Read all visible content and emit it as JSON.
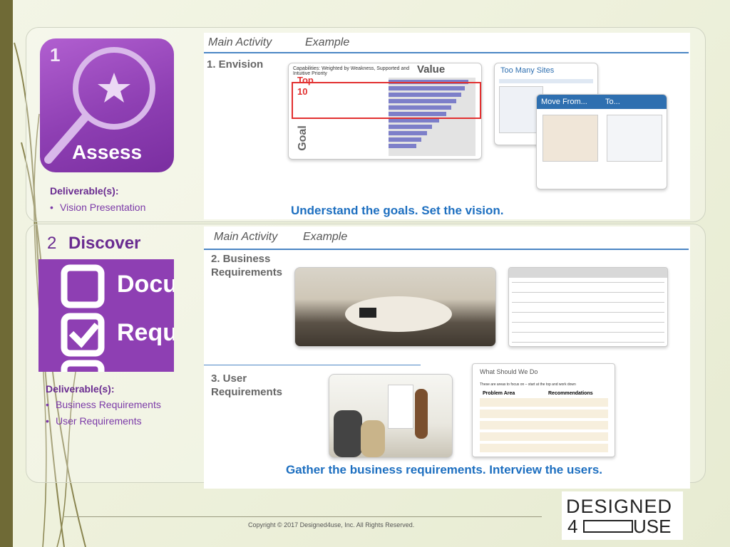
{
  "section1": {
    "badge_number": "1",
    "badge_label": "Assess",
    "deliverables_heading": "Deliverable(s):",
    "deliverables": [
      "Vision Presentation"
    ],
    "col_main": "Main Activity",
    "col_example": "Example",
    "step": "1. Envision",
    "chart_title": "Value",
    "chart_top_label": "Top",
    "chart_top_num": "10",
    "chart_axis_label": "Goal",
    "chart_subtitle": "Capabilities: Weighted by Weakness, Supported and Intuitive Priority",
    "slide1_title": "Too Many Sites",
    "slide2_title": "Move From...",
    "slide2_to": "To...",
    "tagline": "Understand the goals.  Set the vision."
  },
  "section2": {
    "number": "2",
    "title": "Discover",
    "badge_text_1": "Docu",
    "badge_text_2": "Requ",
    "deliverables_heading": "Deliverable(s):",
    "deliverables": [
      "Business Requirements",
      "User Requirements"
    ],
    "col_main": "Main Activity",
    "col_example": "Example",
    "step2_line1": "2. Business",
    "step2_line2": "Requirements",
    "step3_line1": "3. User",
    "step3_line2": "Requirements",
    "doc_title": "What Should We Do",
    "doc_intro": "These are areas to focus on – start at the top and work down",
    "doc_col1": "Problem Area",
    "doc_col2": "Recommendations",
    "tagline": "Gather the business requirements.  Interview the users."
  },
  "footer": {
    "copyright": "Copyright © 2017 Designed4use, Inc. All Rights Reserved.",
    "logo_top": "DESIGNED",
    "logo_num": "4",
    "logo_bottom": "USE"
  },
  "colors": {
    "purple": "#8e3fb3",
    "blue": "#1d6fc0",
    "olive": "#6f6a36"
  }
}
